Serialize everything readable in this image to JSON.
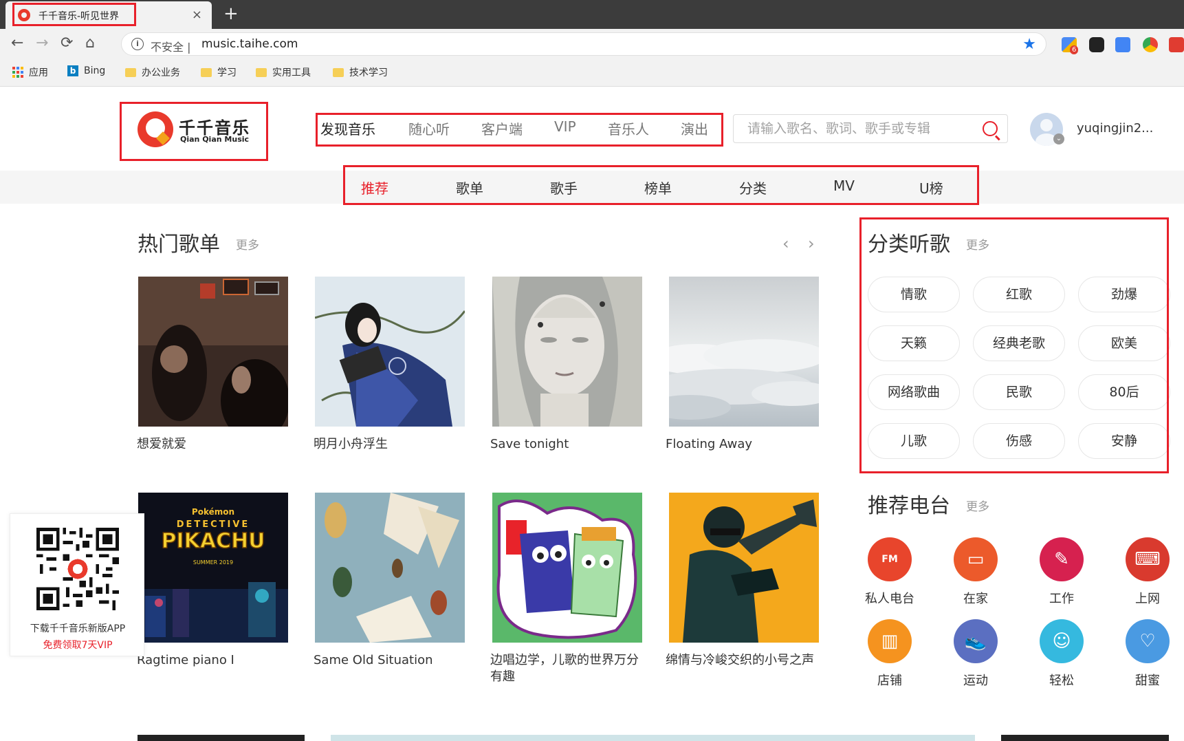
{
  "browser": {
    "tab_title": "千千音乐-听见世界",
    "tab_close": "×",
    "new_tab": "+",
    "back": "←",
    "forward": "→",
    "reload": "⟳",
    "home": "⌂",
    "insecure_label": "不安全 |",
    "url": "music.taihe.com",
    "star": "★",
    "extension_badge": "6",
    "bookmarks": [
      "应用",
      "Bing",
      "办公业务",
      "学习",
      "实用工具",
      "技术学习"
    ]
  },
  "header": {
    "logo_cn": "千千音乐",
    "logo_en": "Qian Qian Music",
    "nav": [
      "发现音乐",
      "随心听",
      "客户端",
      "VIP",
      "音乐人",
      "演出"
    ],
    "search_placeholder": "请输入歌名、歌词、歌手或专辑",
    "username": "yuqingjin2..."
  },
  "subnav": [
    "推荐",
    "歌单",
    "歌手",
    "榜单",
    "分类",
    "MV",
    "U榜"
  ],
  "hot_playlists": {
    "title": "热门歌单",
    "more": "更多",
    "prev": "‹",
    "next": "›",
    "items": [
      "想爱就爱",
      "明月小舟浮生",
      "Save tonight",
      "Floating Away",
      "Ragtime piano I",
      "Same Old Situation",
      "边唱边学，儿歌的世界万分有趣",
      "绵情与冷峻交织的小号之声"
    ],
    "cover_art_text": {
      "pikachu_brand": "Pokémon",
      "pikachu_sub": "DETECTIVE",
      "pikachu_title": "PIKACHU",
      "pikachu_date": "SUMMER 2019"
    }
  },
  "categories": {
    "title": "分类听歌",
    "more": "更多",
    "items": [
      "情歌",
      "红歌",
      "劲爆",
      "天籁",
      "经典老歌",
      "欧美",
      "网络歌曲",
      "民歌",
      "80后",
      "儿歌",
      "伤感",
      "安静"
    ]
  },
  "radio": {
    "title": "推荐电台",
    "more": "更多",
    "items": [
      {
        "label": "私人电台",
        "color": "#e8452c",
        "icon": "fm-radio-icon",
        "glyph": "FM"
      },
      {
        "label": "在家",
        "color": "#ec5a2b",
        "icon": "sofa-icon",
        "glyph": "▭"
      },
      {
        "label": "工作",
        "color": "#d6214f",
        "icon": "desk-lamp-icon",
        "glyph": "✎"
      },
      {
        "label": "上网",
        "color": "#d93a2e",
        "icon": "laptop-wifi-icon",
        "glyph": "⌨"
      },
      {
        "label": "店铺",
        "color": "#f5931f",
        "icon": "shop-icon",
        "glyph": "▥"
      },
      {
        "label": "运动",
        "color": "#5b6fc1",
        "icon": "sneaker-icon",
        "glyph": "👟"
      },
      {
        "label": "轻松",
        "color": "#35b9df",
        "icon": "happy-face-icon",
        "glyph": "☺"
      },
      {
        "label": "甜蜜",
        "color": "#4a9ae2",
        "icon": "hearts-icon",
        "glyph": "♡"
      }
    ]
  },
  "qr_panel": {
    "line1": "下载千千音乐新版APP",
    "line2": "免费领取7天VIP"
  }
}
